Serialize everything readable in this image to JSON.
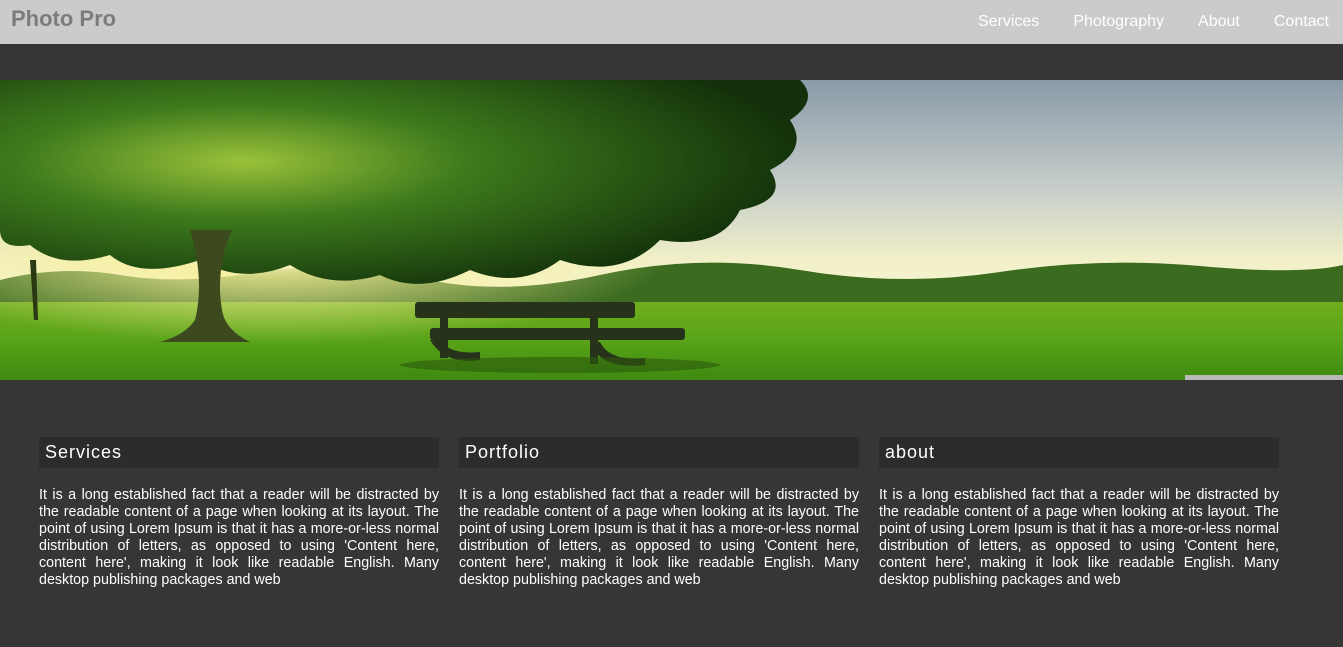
{
  "header": {
    "brand": "Photo Pro",
    "nav": [
      {
        "label": "Services"
      },
      {
        "label": "Photography"
      },
      {
        "label": "About"
      },
      {
        "label": "Contact"
      }
    ]
  },
  "hero": {
    "image": "park-bench-sunset-photo"
  },
  "columns": [
    {
      "title": "Services",
      "text": "It is a long established fact that a reader will be distracted by the readable content of a page when looking at its layout. The point of using Lorem Ipsum is that it has a more-or-less normal distribution of letters, as opposed to using 'Content here, content here', making it look like readable English. Many desktop publishing packages and web"
    },
    {
      "title": "Portfolio",
      "text": "It is a long established fact that a reader will be distracted by the readable content of a page when looking at its layout. The point of using Lorem Ipsum is that it has a more-or-less normal distribution of letters, as opposed to using 'Content here, content here', making it look like readable English. Many desktop publishing packages and web"
    },
    {
      "title": "about",
      "text": "It is a long established fact that a reader will be distracted by the readable content of a page when looking at its layout. The point of using Lorem Ipsum is that it has a more-or-less normal distribution of letters, as opposed to using 'Content here, content here', making it look like readable English. Many desktop publishing packages and web"
    }
  ],
  "colors": {
    "page_background": "#363636",
    "navbar_background": "#cbcbcb",
    "brand_text": "#7c7c7c",
    "heading_background": "#2c2c2c",
    "text": "#ffffff"
  }
}
